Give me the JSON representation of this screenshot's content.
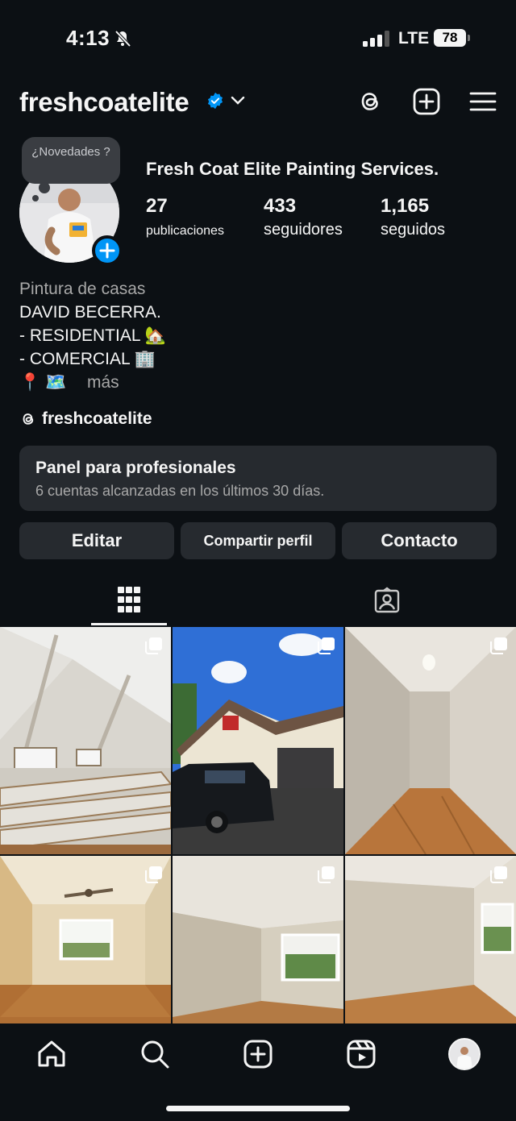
{
  "status_bar": {
    "time": "4:13",
    "network": "LTE",
    "battery": "78"
  },
  "header": {
    "username": "freshcoatelite",
    "icons": [
      "threads-icon",
      "create-icon",
      "menu-icon"
    ]
  },
  "profile": {
    "note": "¿Novedades ?",
    "full_name": "Fresh Coat Elite Painting Services.",
    "stats": [
      {
        "value": "27",
        "label": "publicaciones"
      },
      {
        "value": "433",
        "label": "seguidores"
      },
      {
        "value": "1,165",
        "label": "seguidos"
      }
    ],
    "bio": {
      "category": "Pintura de casas",
      "line1": "DAVID BECERRA.",
      "line2": "- RESIDENTIAL 🏡",
      "line3": "- COMERCIAL 🏢",
      "line4_emojis": "📍 🗺️",
      "more": "más"
    },
    "threads_handle": "freshcoatelite"
  },
  "pro_panel": {
    "title": "Panel para profesionales",
    "subtitle": "6 cuentas alcanzadas en los últimos 30 días."
  },
  "buttons": {
    "edit": "Editar",
    "share": "Compartir perfil",
    "contact": "Contacto"
  },
  "tabs": [
    "grid-icon",
    "tagged-icon"
  ],
  "grid": [
    "church-interior-photo",
    "house-with-suv-photo",
    "hallway-photo",
    "bedroom-ceiling-fan-photo",
    "empty-room-window-photo",
    "empty-room-corner-photo"
  ],
  "bottom_nav": [
    "home-icon",
    "search-icon",
    "create-icon",
    "reels-icon",
    "profile-avatar"
  ],
  "colors": {
    "background": "#0c1014",
    "card": "#262a2f",
    "accent": "#0095f6",
    "secondary_text": "#a8a8a8"
  }
}
